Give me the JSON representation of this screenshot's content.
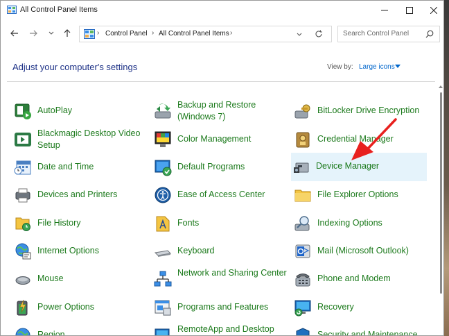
{
  "window": {
    "title": "All Control Panel Items"
  },
  "address_bar": {
    "crumbs": [
      "Control Panel",
      "All Control Panel Items"
    ]
  },
  "search": {
    "placeholder": "Search Control Panel"
  },
  "content": {
    "heading": "Adjust your computer's settings",
    "view_by_label": "View by:",
    "view_by_value": "Large icons",
    "items": [
      {
        "label": "AutoPlay",
        "icon": "autoplay-icon"
      },
      {
        "label": "Backup and Restore (Windows 7)",
        "icon": "backup-restore-icon"
      },
      {
        "label": "BitLocker Drive Encryption",
        "icon": "bitlocker-icon"
      },
      {
        "label": "Blackmagic Desktop Video Setup",
        "icon": "blackmagic-icon"
      },
      {
        "label": "Color Management",
        "icon": "color-management-icon"
      },
      {
        "label": "Credential Manager",
        "icon": "credential-manager-icon"
      },
      {
        "label": "Date and Time",
        "icon": "date-time-icon"
      },
      {
        "label": "Default Programs",
        "icon": "default-programs-icon"
      },
      {
        "label": "Device Manager",
        "icon": "device-manager-icon",
        "highlighted": true
      },
      {
        "label": "Devices and Printers",
        "icon": "devices-printers-icon"
      },
      {
        "label": "Ease of Access Center",
        "icon": "ease-of-access-icon"
      },
      {
        "label": "File Explorer Options",
        "icon": "file-explorer-options-icon"
      },
      {
        "label": "File History",
        "icon": "file-history-icon"
      },
      {
        "label": "Fonts",
        "icon": "fonts-icon"
      },
      {
        "label": "Indexing Options",
        "icon": "indexing-options-icon"
      },
      {
        "label": "Internet Options",
        "icon": "internet-options-icon"
      },
      {
        "label": "Keyboard",
        "icon": "keyboard-icon"
      },
      {
        "label": "Mail (Microsoft Outlook)",
        "icon": "mail-icon"
      },
      {
        "label": "Mouse",
        "icon": "mouse-icon"
      },
      {
        "label": "Network and Sharing Center",
        "icon": "network-sharing-icon"
      },
      {
        "label": "Phone and Modem",
        "icon": "phone-modem-icon"
      },
      {
        "label": "Power Options",
        "icon": "power-options-icon"
      },
      {
        "label": "Programs and Features",
        "icon": "programs-features-icon"
      },
      {
        "label": "Recovery",
        "icon": "recovery-icon"
      },
      {
        "label": "Region",
        "icon": "region-icon"
      },
      {
        "label": "RemoteApp and Desktop",
        "icon": "remoteapp-icon"
      },
      {
        "label": "Security and Maintenance",
        "icon": "security-maintenance-icon"
      }
    ]
  },
  "colors": {
    "link_green": "#1c7a1c",
    "heading_blue": "#1e3287",
    "highlight": "#e5f3fb",
    "annotation_arrow": "#e8201e"
  }
}
